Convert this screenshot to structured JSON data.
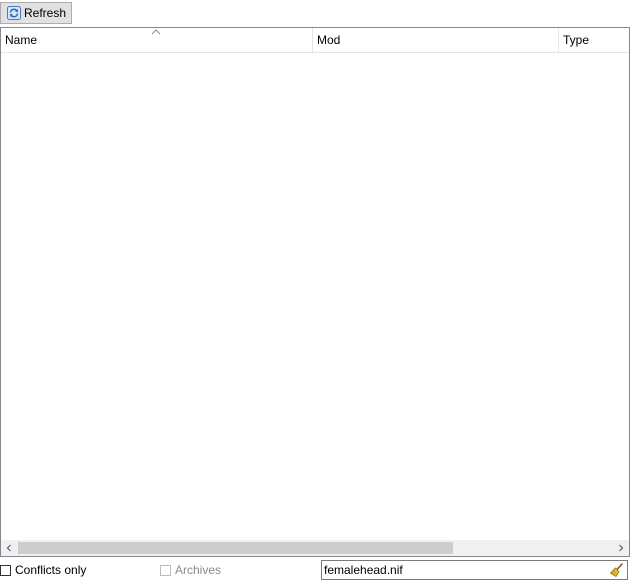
{
  "toolbar": {
    "refresh_label": "Refresh",
    "refresh_icon": "refresh-icon"
  },
  "table": {
    "columns": [
      {
        "label": "Name"
      },
      {
        "label": "Mod"
      },
      {
        "label": "Type"
      }
    ],
    "sort_indicator": "sort-ascending-icon",
    "rows": []
  },
  "scrollbar": {
    "left_arrow": "‹",
    "right_arrow": "›"
  },
  "footer": {
    "conflicts_label": "Conflicts only",
    "conflicts_checked": false,
    "archives_label": "Archives",
    "archives_checked": false,
    "archives_enabled": false,
    "filter_value": "femalehead.nif",
    "clear_icon": "broom-icon"
  },
  "colors": {
    "button_bg": "#e1e1e1",
    "border": "#828790",
    "scroll_thumb": "#cdcdcd",
    "disabled_text": "#8a8a8a"
  }
}
